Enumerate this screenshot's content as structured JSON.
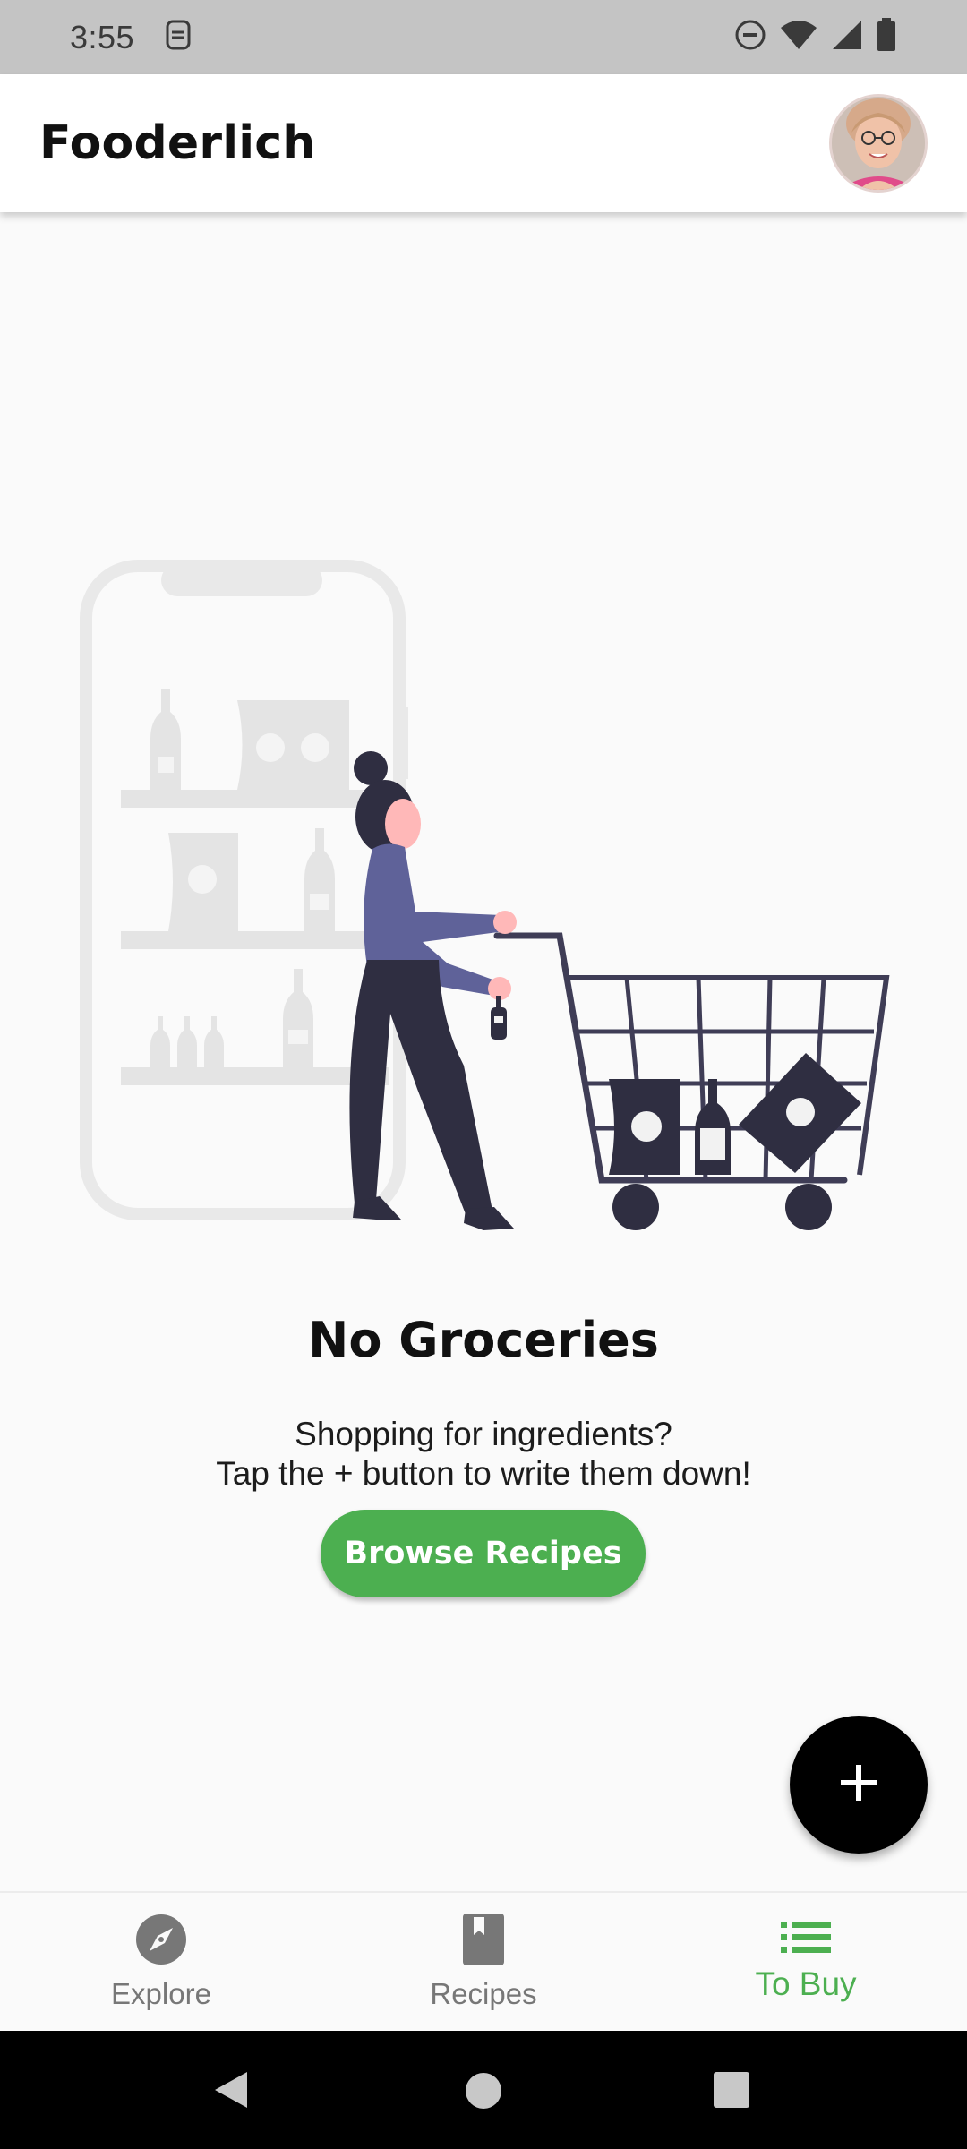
{
  "status_bar": {
    "time": "3:55",
    "icons": [
      "sim-icon",
      "do-not-disturb-icon",
      "wifi-icon",
      "signal-icon",
      "battery-icon"
    ]
  },
  "app_bar": {
    "title": "Fooderlich",
    "avatar": "profile-avatar"
  },
  "empty_state": {
    "illustration": "shopping-cart-illustration",
    "title": "No Groceries",
    "line1": "Shopping for ingredients?",
    "line2": "Tap the + button to write them down!",
    "button_label": "Browse Recipes"
  },
  "fab": {
    "icon": "plus-icon"
  },
  "bottom_nav": {
    "items": [
      {
        "label": "Explore",
        "icon": "compass-icon",
        "active": false
      },
      {
        "label": "Recipes",
        "icon": "book-icon",
        "active": false
      },
      {
        "label": "To Buy",
        "icon": "list-icon",
        "active": true
      }
    ]
  },
  "system_nav": {
    "buttons": [
      "back-icon",
      "home-icon",
      "recents-icon"
    ]
  },
  "colors": {
    "accent": "#4caf50",
    "status_bar": "#c4c4c4",
    "fab": "#000000",
    "inactive": "#777777",
    "illustration_figure": "#2f2e41",
    "illustration_shirt": "#5f6299"
  }
}
